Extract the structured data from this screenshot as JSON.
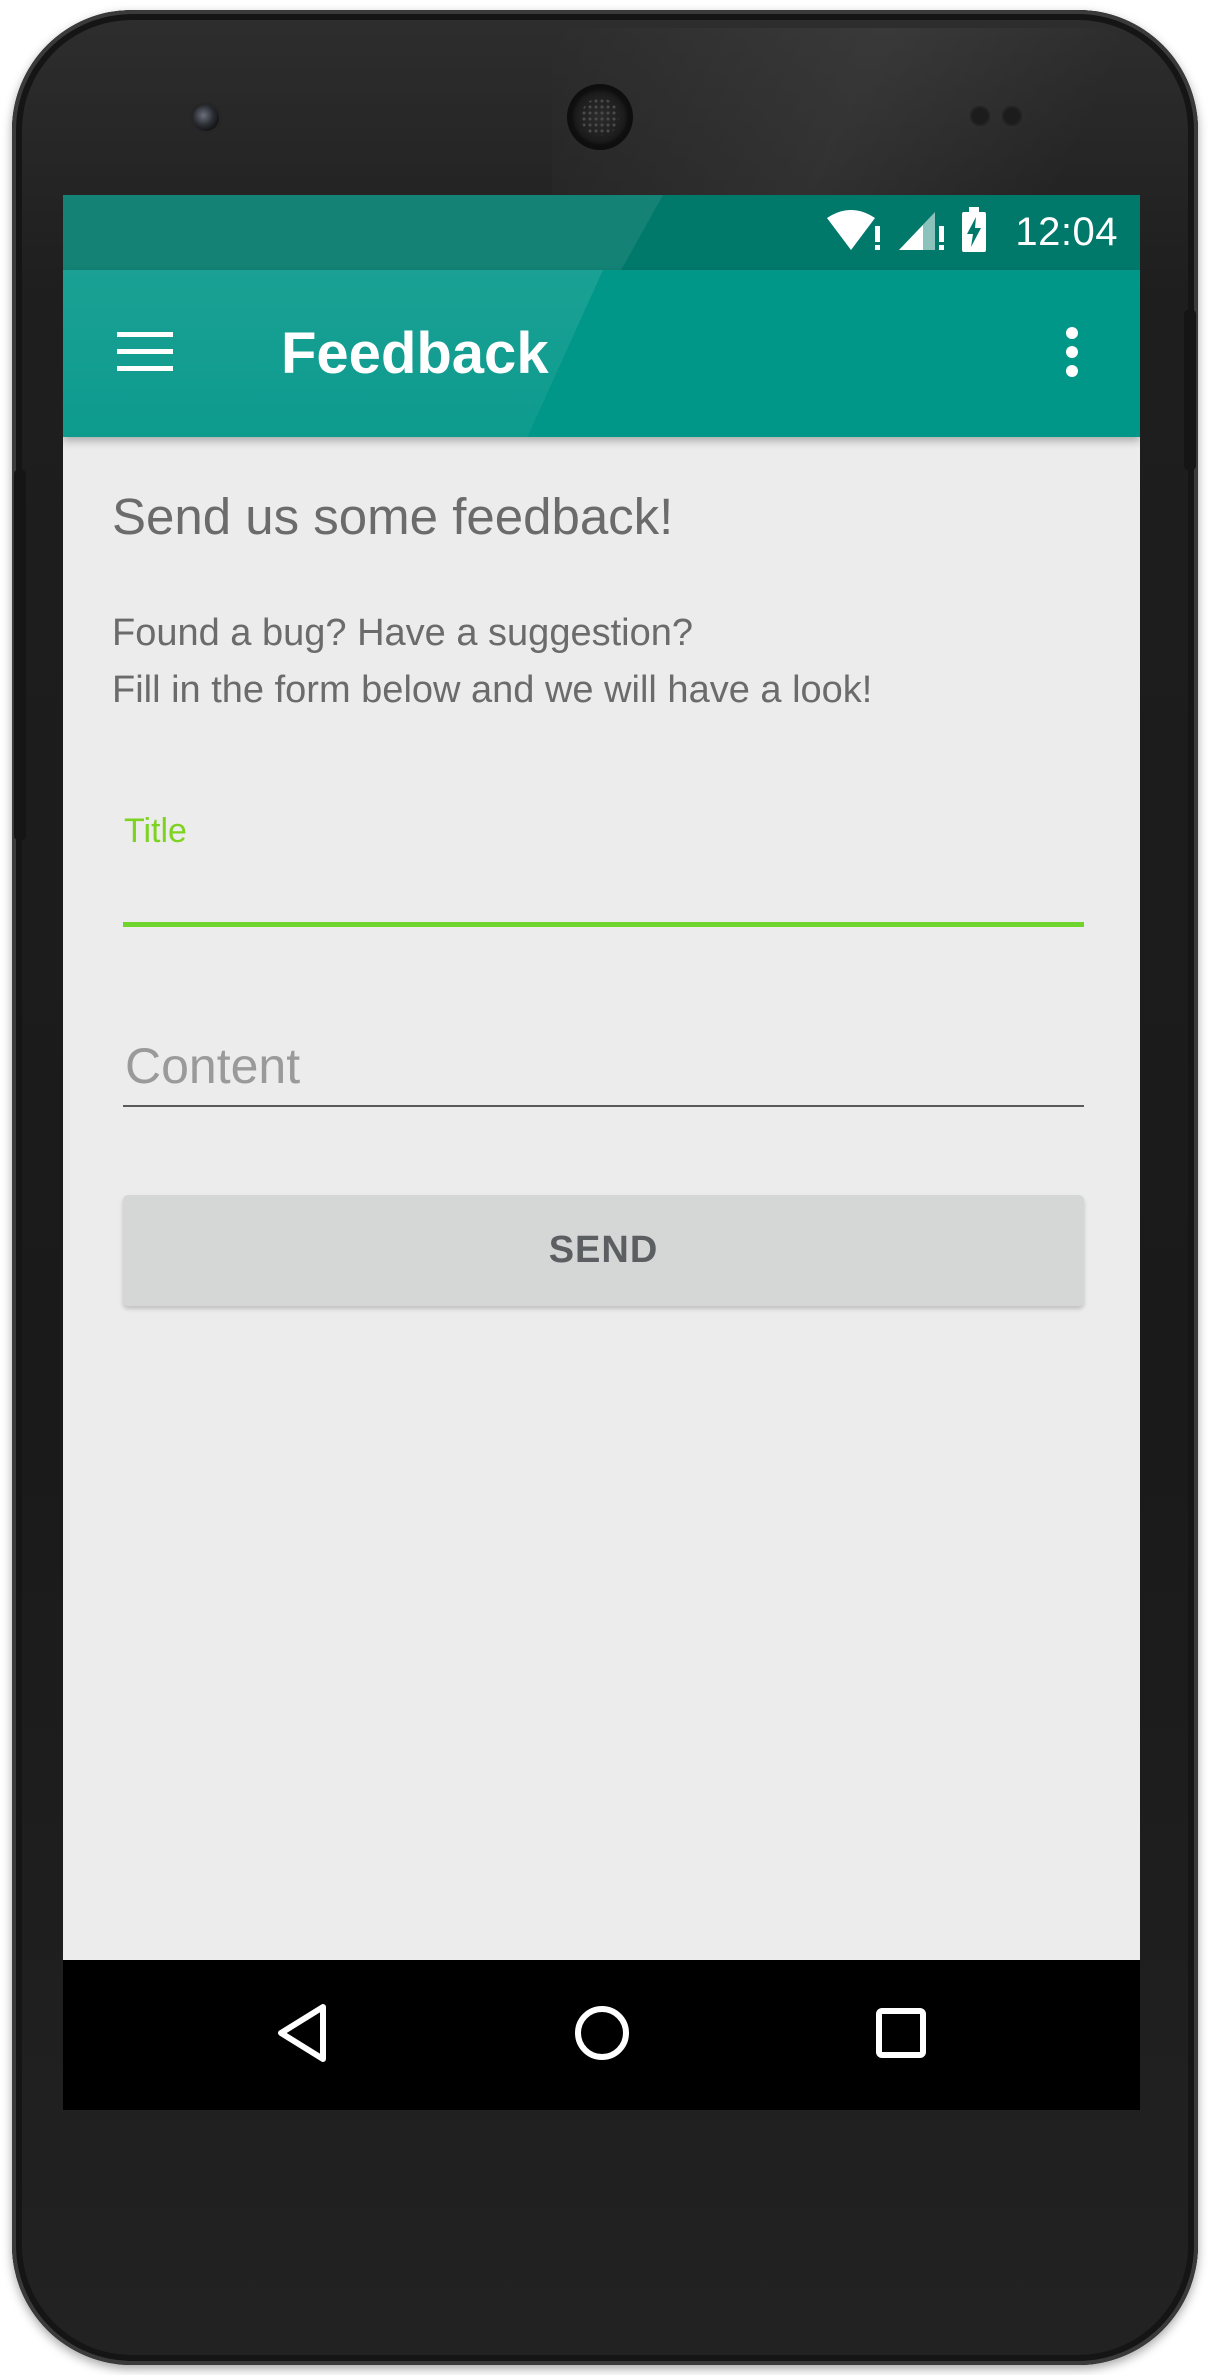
{
  "status_bar": {
    "time": "12:04",
    "icons": [
      "wifi-icon",
      "cell-signal-icon",
      "battery-charging-icon"
    ]
  },
  "app_bar": {
    "title": "Feedback",
    "menu_icon": "hamburger-menu-icon",
    "overflow_icon": "more-vertical-icon"
  },
  "form": {
    "heading": "Send us some feedback!",
    "intro_line1": "Found a bug? Have a suggestion?",
    "intro_line2": "Fill in the form below and we will have a look!",
    "title_label": "Title",
    "title_value": "",
    "content_placeholder": "Content",
    "content_value": "",
    "send_label": "SEND"
  },
  "nav_bar": {
    "buttons": [
      "back-icon",
      "home-icon",
      "recents-icon"
    ]
  },
  "colors": {
    "status_bar": "#00796b",
    "app_bar": "#009688",
    "focused_field_accent": "#6fd42c",
    "screen_background": "#ececec",
    "button": "#d5d6d6"
  }
}
